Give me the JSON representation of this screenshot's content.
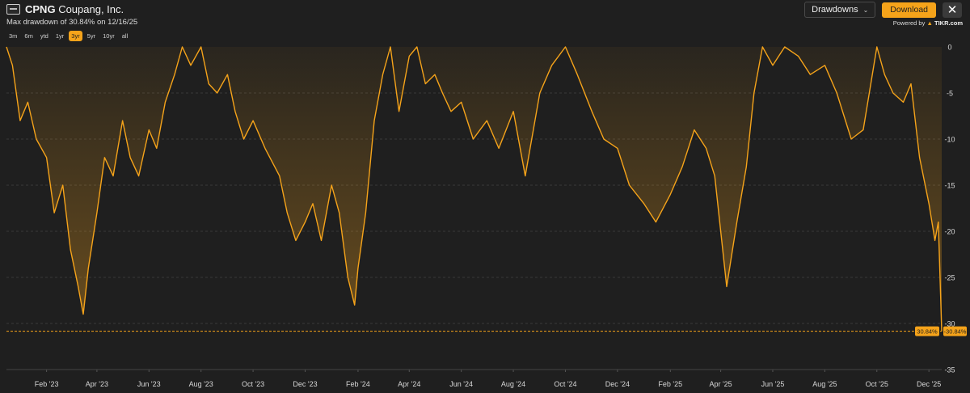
{
  "header": {
    "ticker": "CPNG",
    "company": "Coupang, Inc.",
    "subtitle": "Max drawdown of 30.84% on 12/16/25",
    "metric_select": "Drawdowns",
    "download_label": "Download",
    "close_icon": "close-icon",
    "powered_prefix": "Powered by",
    "powered_brand": "TIKR.com"
  },
  "ranges": [
    {
      "label": "3m",
      "active": false
    },
    {
      "label": "6m",
      "active": false
    },
    {
      "label": "ytd",
      "active": false
    },
    {
      "label": "1yr",
      "active": false
    },
    {
      "label": "3yr",
      "active": true
    },
    {
      "label": "5yr",
      "active": false
    },
    {
      "label": "10yr",
      "active": false
    },
    {
      "label": "all",
      "active": false
    }
  ],
  "colors": {
    "line": "#f5a31a",
    "background": "#1f1f1f",
    "grid": "#3a3a3a",
    "max_line": "#f5a31a"
  },
  "chart_data": {
    "type": "area",
    "title": "",
    "xlabel": "",
    "ylabel": "",
    "ylim": [
      -35,
      0
    ],
    "yticks": [
      0,
      -5,
      -10,
      -15,
      -20,
      -25,
      -30,
      -35
    ],
    "ytick_labels": [
      "0",
      "-5",
      "-10",
      "-15",
      "-20",
      "-25",
      "-30",
      "-35"
    ],
    "x_tick_labels": [
      "Feb '23",
      "Apr '23",
      "Jun '23",
      "Aug '23",
      "Oct '23",
      "Dec '23",
      "Feb '24",
      "Apr '24",
      "Jun '24",
      "Aug '24",
      "Oct '24",
      "Dec '24",
      "Feb '25",
      "Apr '25",
      "Jun '25",
      "Aug '25",
      "Oct '25",
      "Dec '25"
    ],
    "x_tick_dates": [
      "2023-02-01",
      "2023-04-01",
      "2023-06-01",
      "2023-08-01",
      "2023-10-01",
      "2023-12-01",
      "2024-02-01",
      "2024-04-01",
      "2024-06-01",
      "2024-08-01",
      "2024-10-01",
      "2024-12-01",
      "2025-02-01",
      "2025-04-01",
      "2025-06-01",
      "2025-08-01",
      "2025-10-01",
      "2025-12-01"
    ],
    "x_range": [
      "2022-12-16",
      "2025-12-16"
    ],
    "grid": true,
    "max_drawdown": -30.84,
    "max_label_left": "30.84%",
    "max_label_right": "-30.84%",
    "series": [
      {
        "dates": [
          "2022-12-16",
          "2022-12-23",
          "2023-01-01",
          "2023-01-10",
          "2023-01-20",
          "2023-02-01",
          "2023-02-10",
          "2023-02-20",
          "2023-03-01",
          "2023-03-10",
          "2023-03-16",
          "2023-03-22",
          "2023-04-01",
          "2023-04-10",
          "2023-04-20",
          "2023-05-01",
          "2023-05-10",
          "2023-05-20",
          "2023-06-01",
          "2023-06-10",
          "2023-06-20",
          "2023-07-01",
          "2023-07-10",
          "2023-07-20",
          "2023-08-01",
          "2023-08-10",
          "2023-08-20",
          "2023-09-01",
          "2023-09-10",
          "2023-09-20",
          "2023-10-01",
          "2023-10-15",
          "2023-11-01",
          "2023-11-10",
          "2023-11-20",
          "2023-12-01",
          "2023-12-10",
          "2023-12-20",
          "2024-01-01",
          "2024-01-10",
          "2024-01-20",
          "2024-01-28",
          "2024-02-01",
          "2024-02-10",
          "2024-02-20",
          "2024-03-01",
          "2024-03-10",
          "2024-03-20",
          "2024-04-01",
          "2024-04-10",
          "2024-04-20",
          "2024-05-01",
          "2024-05-10",
          "2024-05-20",
          "2024-06-01",
          "2024-06-15",
          "2024-07-01",
          "2024-07-15",
          "2024-08-01",
          "2024-08-15",
          "2024-09-01",
          "2024-09-15",
          "2024-10-01",
          "2024-10-15",
          "2024-11-01",
          "2024-11-15",
          "2024-12-01",
          "2024-12-15",
          "2025-01-01",
          "2025-01-15",
          "2025-02-01",
          "2025-02-15",
          "2025-03-01",
          "2025-03-15",
          "2025-03-25",
          "2025-04-01",
          "2025-04-08",
          "2025-04-20",
          "2025-05-01",
          "2025-05-10",
          "2025-05-20",
          "2025-06-01",
          "2025-06-15",
          "2025-07-01",
          "2025-07-15",
          "2025-08-01",
          "2025-08-15",
          "2025-09-01",
          "2025-09-15",
          "2025-10-01",
          "2025-10-10",
          "2025-10-20",
          "2025-11-01",
          "2025-11-10",
          "2025-11-20",
          "2025-12-01",
          "2025-12-08",
          "2025-12-12",
          "2025-12-16"
        ],
        "values": [
          0,
          -2,
          -8,
          -6,
          -10,
          -12,
          -18,
          -15,
          -22,
          -26,
          -29,
          -24,
          -18,
          -12,
          -14,
          -8,
          -12,
          -14,
          -9,
          -11,
          -6,
          -3,
          0,
          -2,
          0,
          -4,
          -5,
          -3,
          -7,
          -10,
          -8,
          -11,
          -14,
          -18,
          -21,
          -19,
          -17,
          -21,
          -15,
          -18,
          -25,
          -28,
          -24,
          -18,
          -8,
          -3,
          0,
          -7,
          -1,
          0,
          -4,
          -3,
          -5,
          -7,
          -6,
          -10,
          -8,
          -11,
          -7,
          -14,
          -5,
          -2,
          0,
          -3,
          -7,
          -10,
          -11,
          -15,
          -17,
          -19,
          -16,
          -13,
          -9,
          -11,
          -14,
          -20,
          -26,
          -19,
          -13,
          -5,
          0,
          -2,
          0,
          -1,
          -3,
          -2,
          -5,
          -10,
          -9,
          0,
          -3,
          -5,
          -6,
          -4,
          -12,
          -17,
          -21,
          -19,
          -30.84
        ]
      }
    ]
  }
}
